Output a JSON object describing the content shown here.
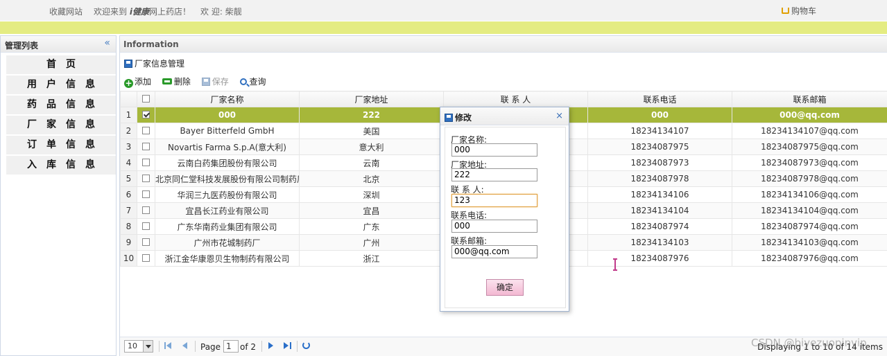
{
  "topbar": {
    "favorite": "收藏网站",
    "welcome_prefix": "欢迎来到",
    "brand": "i健康",
    "welcome_suffix": "网上药店！",
    "greeting": "欢 迎: 柴靓",
    "cart": "购物车"
  },
  "left_panel": {
    "title": "管理列表",
    "collapse_icon": "«",
    "menu": [
      "首页",
      "用户信息",
      "药品信息",
      "厂家信息",
      "订单信息",
      "入库信息"
    ]
  },
  "right_panel": {
    "title": "Information",
    "subtitle": "厂家信息管理",
    "toolbar": {
      "add": "添加",
      "delete": "删除",
      "save": "保存",
      "search": "查询"
    }
  },
  "grid": {
    "columns": [
      "厂家名称",
      "厂家地址",
      "联 系 人",
      "联系电话",
      "联系邮箱"
    ],
    "rows": [
      {
        "n": "1",
        "checked": true,
        "name": "000",
        "addr": "222",
        "contact": "",
        "phone": "000",
        "email": "000@qq.com"
      },
      {
        "n": "2",
        "checked": false,
        "name": "Bayer Bitterfeld GmbH",
        "addr": "美国",
        "contact": "",
        "phone": "18234134107",
        "email": "18234134107@qq.com"
      },
      {
        "n": "3",
        "checked": false,
        "name": "Novartis Farma S.p.A(意大利)",
        "addr": "意大利",
        "contact": "",
        "phone": "18234087975",
        "email": "18234087975@qq.com"
      },
      {
        "n": "4",
        "checked": false,
        "name": "云南白药集团股份有限公司",
        "addr": "云南",
        "contact": "",
        "phone": "18234087973",
        "email": "18234087973@qq.com"
      },
      {
        "n": "5",
        "checked": false,
        "name": "北京同仁堂科技发展股份有限公司制药厂",
        "addr": "北京",
        "contact": "",
        "phone": "18234087978",
        "email": "18234087978@qq.com"
      },
      {
        "n": "6",
        "checked": false,
        "name": "华润三九医药股份有限公司",
        "addr": "深圳",
        "contact": "",
        "phone": "18234134106",
        "email": "18234134106@qq.com"
      },
      {
        "n": "7",
        "checked": false,
        "name": "宜昌长江药业有限公司",
        "addr": "宜昌",
        "contact": "",
        "phone": "18234134104",
        "email": "18234134104@qq.com"
      },
      {
        "n": "8",
        "checked": false,
        "name": "广东华南药业集团有限公司",
        "addr": "广东",
        "contact": "",
        "phone": "18234087974",
        "email": "18234087974@qq.com"
      },
      {
        "n": "9",
        "checked": false,
        "name": "广州市花城制药厂",
        "addr": "广州",
        "contact": "",
        "phone": "18234134103",
        "email": "18234134103@qq.com"
      },
      {
        "n": "10",
        "checked": false,
        "name": "浙江金华康恩贝生物制药有限公司",
        "addr": "浙江",
        "contact": "",
        "phone": "18234087976",
        "email": "18234087976@qq.com"
      }
    ]
  },
  "pager": {
    "page_size": "10",
    "page_label": "Page",
    "page_value": "1",
    "of_label": "of 2",
    "display": "Displaying 1 to 10 of 14 items"
  },
  "dialog": {
    "title": "修改",
    "close": "×",
    "fields": [
      {
        "label": "厂家名称:",
        "value": "000"
      },
      {
        "label": "厂家地址:",
        "value": "222"
      },
      {
        "label": "联 系 人:",
        "value": "123"
      },
      {
        "label": "联系电话:",
        "value": "000"
      },
      {
        "label": "联系邮箱:",
        "value": "000@qq.com"
      }
    ],
    "ok": "确定"
  },
  "watermark": "CSDN @biyezuopinvip"
}
